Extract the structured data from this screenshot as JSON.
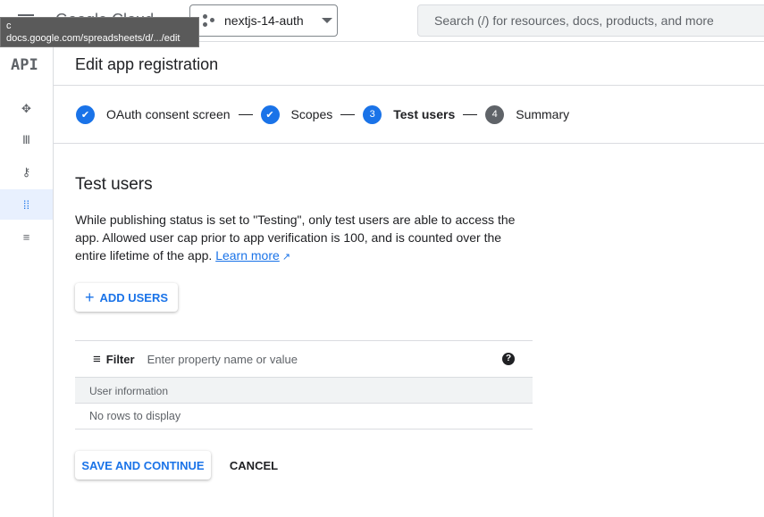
{
  "header": {
    "logo": "Google Cloud",
    "project": "nextjs-14-auth",
    "search_placeholder": "Search (/) for resources, docs, products, and more"
  },
  "tooltip": {
    "line1": "c",
    "line2": "docs.google.com/spreadsheets/d/.../edit"
  },
  "sidebar": {
    "logo": "API",
    "items": [
      {
        "icon": "dashboard-icon",
        "glyph": "✥"
      },
      {
        "icon": "library-icon",
        "glyph": "Ⅲ"
      },
      {
        "icon": "key-icon",
        "glyph": "⚷"
      },
      {
        "icon": "oauth-consent-icon",
        "glyph": "⁞⁞"
      },
      {
        "icon": "settings-list-icon",
        "glyph": "≡"
      }
    ]
  },
  "page": {
    "title": "Edit app registration"
  },
  "stepper": [
    {
      "label": "OAuth consent screen",
      "state": "done"
    },
    {
      "label": "Scopes",
      "state": "done"
    },
    {
      "num": "3",
      "label": "Test users",
      "state": "active"
    },
    {
      "num": "4",
      "label": "Summary",
      "state": "pending"
    }
  ],
  "section": {
    "title": "Test users",
    "desc": "While publishing status is set to \"Testing\", only test users are able to access the app. Allowed user cap prior to app verification is 100, and is counted over the entire lifetime of the app. ",
    "learn_more": "Learn more"
  },
  "add_users": "ADD USERS",
  "table": {
    "filter_label": "Filter",
    "filter_placeholder": "Enter property name or value",
    "column": "User information",
    "empty": "No rows to display"
  },
  "actions": {
    "save": "SAVE AND CONTINUE",
    "cancel": "CANCEL"
  },
  "colors": {
    "accent": "#1a73e8"
  }
}
